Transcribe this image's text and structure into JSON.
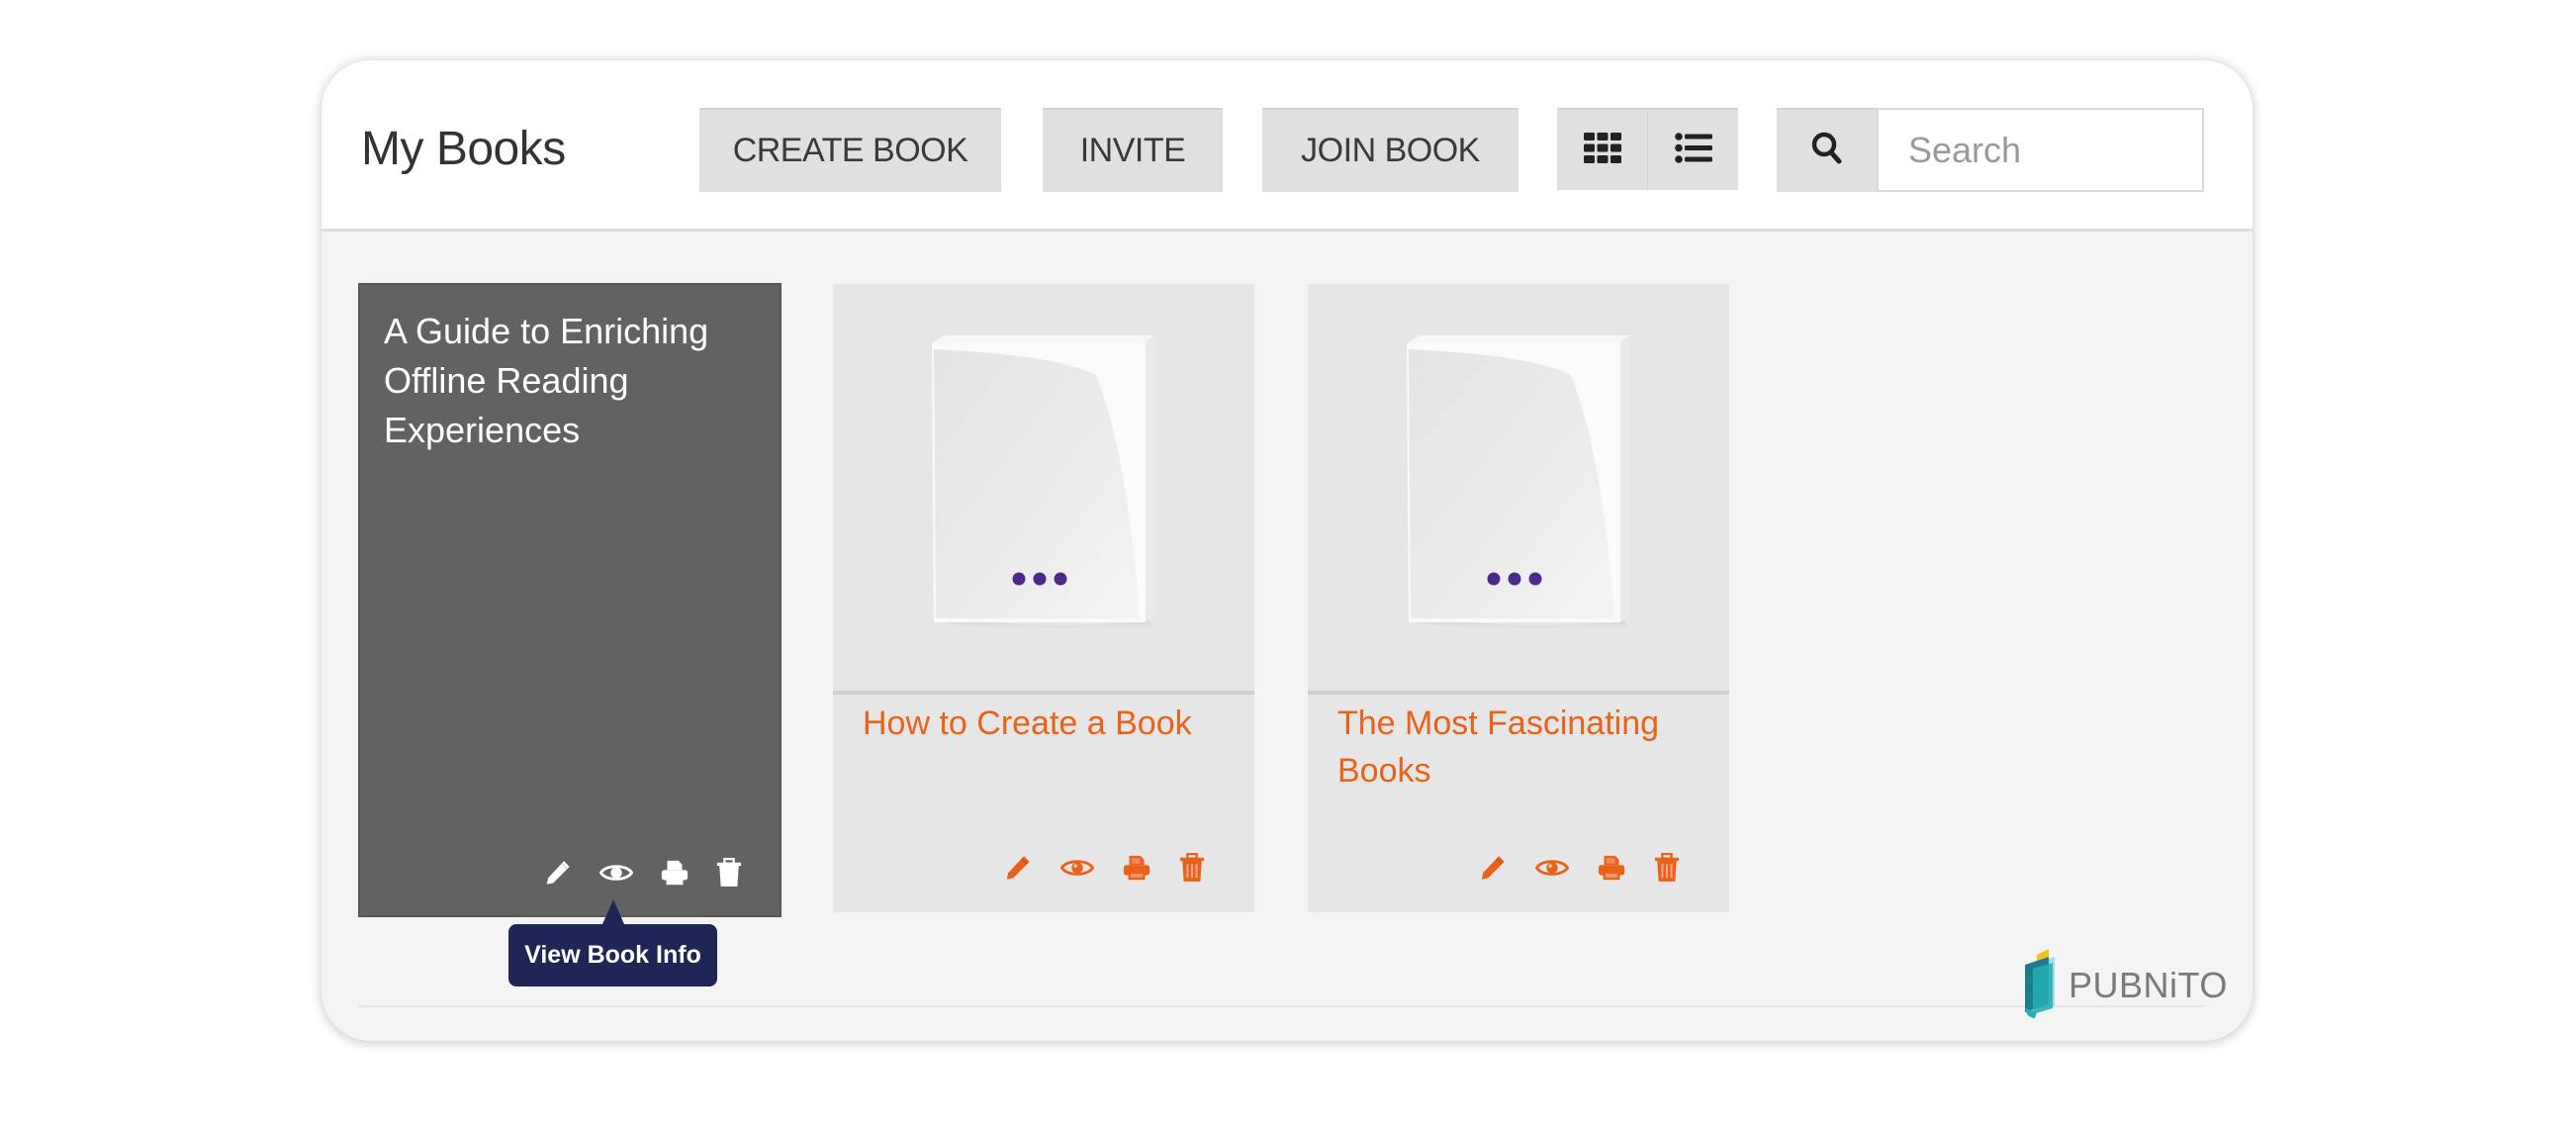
{
  "header": {
    "title": "My Books",
    "buttons": {
      "create_book": "CREATE BOOK",
      "invite": "INVITE",
      "join_book": "JOIN BOOK"
    },
    "view_toggle": {
      "grid_icon": "grid-icon",
      "list_icon": "list-icon"
    },
    "search": {
      "icon": "search-icon",
      "placeholder": "Search",
      "value": ""
    }
  },
  "books": [
    {
      "title": "A Guide to Enriching Offline Reading Experiences",
      "state": "hovered",
      "actions": [
        "edit",
        "view-info",
        "print",
        "delete"
      ]
    },
    {
      "title": "How to Create a Book",
      "cover": "default-cover",
      "actions": [
        "edit",
        "view-info",
        "print",
        "delete"
      ]
    },
    {
      "title": "The Most Fascinating Books",
      "cover": "default-cover",
      "actions": [
        "edit",
        "view-info",
        "print",
        "delete"
      ]
    }
  ],
  "tooltip": {
    "text": "View Book Info"
  },
  "brand": {
    "logo_text": "PUBNiTO"
  },
  "colors": {
    "accent": "#e8621a",
    "tooltip_bg": "#1f2656",
    "hover_card_bg": "#626262",
    "cover_dots": "#4b2a8a"
  }
}
